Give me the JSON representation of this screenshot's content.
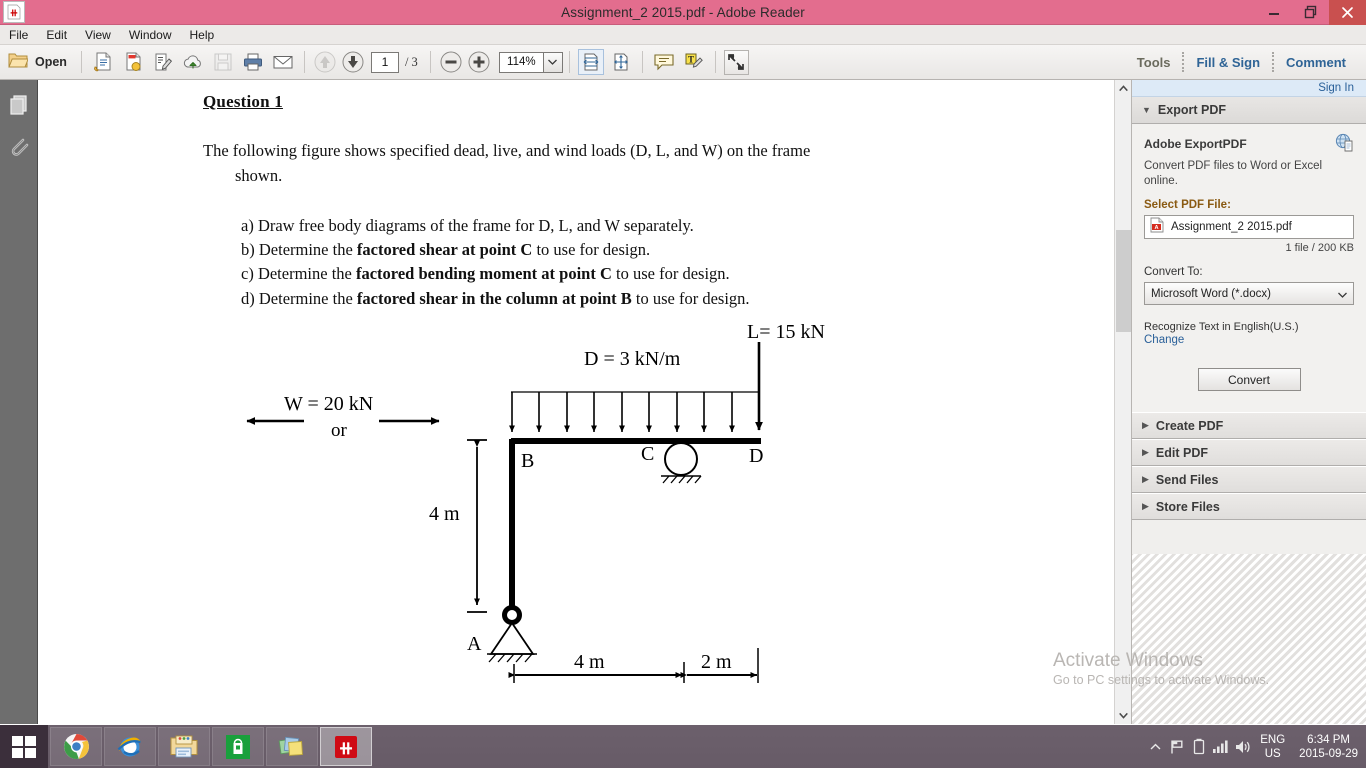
{
  "window": {
    "title": "Assignment_2 2015.pdf - Adobe Reader",
    "app_icon": "adobe-reader-icon",
    "minimize": "minimize-icon",
    "restore": "restore-icon",
    "close": "close-icon"
  },
  "menu": {
    "items": [
      {
        "label": "File"
      },
      {
        "label": "Edit"
      },
      {
        "label": "View"
      },
      {
        "label": "Window"
      },
      {
        "label": "Help"
      }
    ]
  },
  "toolbar": {
    "open_label": "Open",
    "open_icon": "folder-open-icon",
    "icons": [
      {
        "name": "create-pdf-icon"
      },
      {
        "name": "export-pdf-icon"
      },
      {
        "name": "edit-pdf-icon"
      },
      {
        "name": "cloud-upload-icon"
      },
      {
        "name": "save-icon"
      },
      {
        "name": "print-icon"
      },
      {
        "name": "email-icon"
      }
    ],
    "prev_page_icon": "arrow-up-icon",
    "next_page_icon": "arrow-down-icon",
    "page_current": "1",
    "page_total": "/ 3",
    "zoom_out_icon": "zoom-out-icon",
    "zoom_in_icon": "zoom-in-icon",
    "zoom_value": "114%",
    "zoom_dropdown_icon": "chevron-down-icon",
    "fit_width_icon": "fit-width-icon",
    "fit_page_icon": "fit-page-icon",
    "comment_icon": "comment-bubble-icon",
    "highlight_icon": "highlight-text-icon",
    "fullscreen_icon": "fullscreen-icon",
    "right_links": [
      {
        "label": "Tools"
      },
      {
        "label": "Fill & Sign"
      },
      {
        "label": "Comment"
      }
    ]
  },
  "left_rail": {
    "items": [
      {
        "name": "page-thumbnails-icon"
      },
      {
        "name": "attachments-icon"
      }
    ]
  },
  "document": {
    "question_title": "Question 1",
    "intro_line1": "The following figure shows specified dead, live, and wind loads (D, L, and W) on the frame",
    "intro_line2": "shown.",
    "items": [
      {
        "prefix": "a) Draw free body diagrams of the frame for D, L, and W separately.",
        "bold": "",
        "suffix": ""
      },
      {
        "prefix": "b) Determine the ",
        "bold": "factored shear at point C",
        "suffix": " to use for design."
      },
      {
        "prefix": "c) Determine the ",
        "bold": "factored bending moment at point C",
        "suffix": " to use for design."
      },
      {
        "prefix": "d) Determine the ",
        "bold": "factored shear in the column at point B",
        "suffix": " to use for design."
      }
    ]
  },
  "figure": {
    "type": "structural-frame-diagram",
    "labels": {
      "live_load": "L= 15 kN",
      "dead_load": "D = 3 kN/m",
      "wind_load": "W = 20 kN",
      "wind_or": "or",
      "height_dim": "4 m",
      "span_dim_1": "4 m",
      "span_dim_2": "2 m",
      "node_a": "A",
      "node_b": "B",
      "node_c": "C",
      "node_d": "D"
    },
    "distributed_arrow_count": 10,
    "supports": {
      "a": "pin-support",
      "c": "roller-support"
    }
  },
  "scrollbar": {
    "up_icon": "scroll-up-icon",
    "down_icon": "scroll-down-icon"
  },
  "right_panel": {
    "signin_label": "Sign In",
    "export_header": "Export PDF",
    "export_header_icon": "triangle-down-icon",
    "product_title": "Adobe ExportPDF",
    "product_icon": "globe-document-icon",
    "product_desc": "Convert PDF files to Word or Excel online.",
    "select_file_label": "Select PDF File:",
    "file_name": "Assignment_2 2015.pdf",
    "file_icon": "pdf-file-icon",
    "file_size": "1 file / 200 KB",
    "convert_to_label": "Convert To:",
    "convert_to_value": "Microsoft Word (*.docx)",
    "convert_to_icon": "chevron-down-icon",
    "recognize_text": "Recognize Text in English(U.S.)",
    "change_link": "Change",
    "convert_button": "Convert",
    "accordions": [
      {
        "label": "Create PDF",
        "icon": "triangle-right-icon"
      },
      {
        "label": "Edit PDF",
        "icon": "triangle-right-icon"
      },
      {
        "label": "Send Files",
        "icon": "triangle-right-icon"
      },
      {
        "label": "Store Files",
        "icon": "triangle-right-icon"
      }
    ]
  },
  "watermark": {
    "line1": "Activate Windows",
    "line2": "Go to PC settings to activate Windows."
  },
  "taskbar": {
    "start_icon": "windows-start-icon",
    "apps": [
      {
        "name": "chrome-icon"
      },
      {
        "name": "internet-explorer-icon"
      },
      {
        "name": "file-explorer-icon"
      },
      {
        "name": "windows-store-icon"
      },
      {
        "name": "sticky-notes-icon"
      },
      {
        "name": "adobe-reader-icon"
      }
    ],
    "tray": {
      "expand_icon": "show-hidden-icons-icon",
      "flag_icon": "action-center-flag-icon",
      "battery_icon": "battery-icon",
      "network_icon": "network-signal-icon",
      "volume_icon": "volume-icon",
      "lang_line1": "ENG",
      "lang_line2": "US",
      "time": "6:34 PM",
      "date": "2015-09-29"
    }
  },
  "colors": {
    "titlebar": "#e36d8e",
    "close_button": "#c9504f",
    "accent_link": "#2a6099",
    "taskbar": "#6c606c"
  }
}
